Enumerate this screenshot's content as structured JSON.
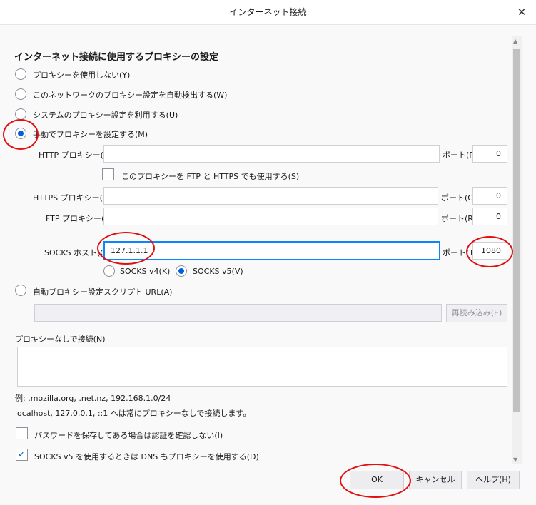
{
  "window": {
    "title": "インターネット接続",
    "close_glyph": "✕"
  },
  "heading": "インターネット接続に使用するプロキシーの設定",
  "proxy_options": [
    {
      "label": "プロキシーを使用しない(Y)",
      "selected": false
    },
    {
      "label": "このネットワークのプロキシー設定を自動検出する(W)",
      "selected": false
    },
    {
      "label": "システムのプロキシー設定を利用する(U)",
      "selected": false
    },
    {
      "label": "手動でプロキシーを設定する(M)",
      "selected": true
    }
  ],
  "manual": {
    "http_label": "HTTP プロキシー(X)",
    "http_value": "",
    "http_port_label": "ポート(P)",
    "http_port": "0",
    "also_use_label": "このプロキシーを FTP と HTTPS でも使用する(S)",
    "also_use_checked": false,
    "https_label": "HTTPS プロキシー(H)",
    "https_value": "",
    "https_port_label": "ポート(O)",
    "https_port": "0",
    "ftp_label": "FTP プロキシー(F)",
    "ftp_value": "",
    "ftp_port_label": "ポート(R)",
    "ftp_port": "0",
    "socks_label": "SOCKS ホスト(C)",
    "socks_value": "127.1.1.1",
    "socks_port_label": "ポート(T)",
    "socks_port": "1080",
    "socks_v4_label": "SOCKS v4(K)",
    "socks_v5_label": "SOCKS v5(V)",
    "socks_version": "v5"
  },
  "auto_config": {
    "label": "自動プロキシー設定スクリプト URL(A)",
    "value": "",
    "reload_label": "再読み込み(E)"
  },
  "no_proxy": {
    "label": "プロキシーなしで接続(N)",
    "value": "",
    "example": "例: .mozilla.org, .net.nz, 192.168.1.0/24",
    "note": "localhost, 127.0.0.1, ::1 へは常にプロキシーなしで接続します。"
  },
  "options": {
    "no_auth_prompt_label": "パスワードを保存してある場合は認証を確認しない(I)",
    "no_auth_prompt_checked": false,
    "socks_dns_label": "SOCKS v5 を使用するときは DNS もプロキシーを使用する(D)",
    "socks_dns_checked": true
  },
  "buttons": {
    "ok": "OK",
    "cancel": "キャンセル",
    "help": "ヘルプ(H)"
  },
  "annotation_color": "#e01010",
  "accent_color": "#0060df"
}
